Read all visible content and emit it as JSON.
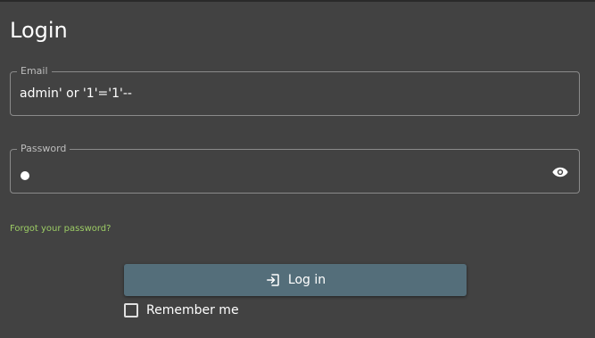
{
  "title": "Login",
  "email": {
    "label": "Email",
    "value": "admin' or '1'='1'--"
  },
  "password": {
    "label": "Password",
    "masked_length": 1,
    "toggle_icon": "eye-icon"
  },
  "forgot_link": "Forgot your password?",
  "login_button": {
    "label": "Log in",
    "icon": "login-icon"
  },
  "remember_me": {
    "label": "Remember me",
    "checked": false
  },
  "colors": {
    "background": "#424242",
    "button": "#546e7a",
    "link": "#9ccc65"
  }
}
